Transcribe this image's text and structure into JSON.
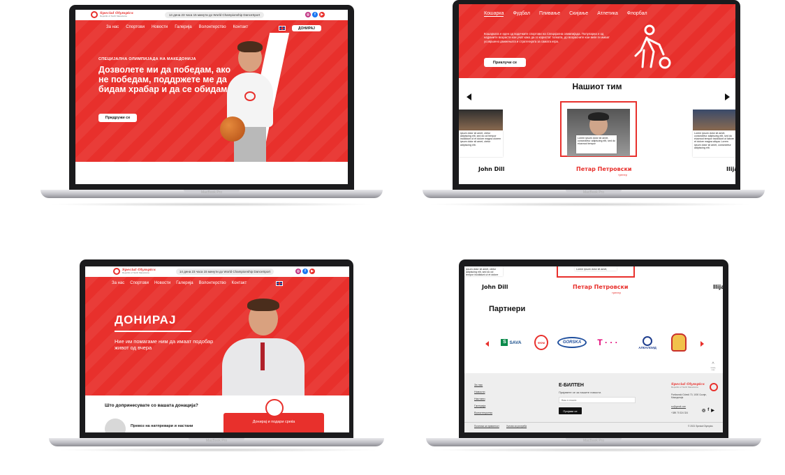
{
  "laptop_model": "MacBook Pro",
  "brand": {
    "logo_line1": "Special Olympics",
    "logo_line2": "Republic of North Macedonia"
  },
  "topbar": {
    "countdown": "14 дена 23 часа 15 минути до World Championship DanceSport"
  },
  "nav": [
    "За нас",
    "Спортови",
    "Новости",
    "Галерија",
    "Волонтерство",
    "Контакт"
  ],
  "donate_button": "ДОНИРАЈ",
  "hero": {
    "kicker": "СПЕЦИЈАЛНА ОЛИМПИЈАДА НА МАКЕДОНИЈА",
    "headline": "Дозволете ми да победам, ако не победам, поддржете ме да бидам храбар и да се обидам",
    "cta": "Придружи се"
  },
  "sports": {
    "tabs": [
      "Кошарка",
      "Фудбал",
      "Пливање",
      "Скијање",
      "Атлетика",
      "Флорбал"
    ],
    "active_tab": "Кошарка",
    "description": "Кошарката е еден од водечките спортови на Специјална олимпијада. Популарна е од најраните возрасти кои учат како да го користат топката, до возрасните кои веќе ги имаат усовршено движењата и стратегијата за самата игра.",
    "cta": "Приклучи се"
  },
  "team": {
    "title": "Нашиот тим",
    "lorem_left": "ipsum dolor sit amet, ctetur adipiscing elit, sed do od tempor incididunt ut et dolore magna olorem ipsum dolor sit amet, ctetur adipiscing elit.",
    "lorem_center": "Lorem ipsum dolor sit amet, consectetur adipiscing elit, sed do eiusmod tempor",
    "lorem_right": "Lorem ipsum dolor sit amet, consectetur adipiscing elit, sed do eiusmod tempor incididunt ut labore et dolore magna aliqua. Lorem ipsum dolor sit amet, consectetur adipiscing elit.",
    "members": [
      {
        "name": "John Dill",
        "role": ""
      },
      {
        "name": "Петар Петровски",
        "role": "тренер"
      },
      {
        "name": "Ilija",
        "role": ""
      }
    ]
  },
  "donate_page": {
    "title": "ДОНИРАЈ",
    "subtitle": "Ние им помагаме ним да имаат подобар живот од вчера",
    "question": "Што допринесувате со вашата донација?",
    "item": "Превоз на натпревари и настани",
    "card_button": "Донирај и подари среќа"
  },
  "partners": {
    "title": "Партнери",
    "logos": [
      "SAVA",
      "ФФМ",
      "GORSKA",
      "T · · ·",
      "АЛКАЛОИД",
      "crest"
    ],
    "back_to_top": "назад горе"
  },
  "footer": {
    "links": [
      "За нас",
      "Новости",
      "Настани",
      "Галерија",
      "Волонтерство"
    ],
    "newsletter_title": "Е-БИЛТЕН",
    "newsletter_text": "Пријавете се за нашите новости.",
    "email_placeholder": "Ваш е-пошта",
    "subscribe": "Пријави се",
    "address": "Partizanski Odredi 70, 1000 Скопје, Македонија",
    "email": "so@gmail.com",
    "phone": "+389 70 324 324",
    "bottom_links": [
      "Политика за приватност",
      "Услови за употреба"
    ],
    "copyright": "© 2021 Special Olympics"
  },
  "colors": {
    "brand_red": "#e8302c",
    "dark": "#1b1b1d"
  }
}
